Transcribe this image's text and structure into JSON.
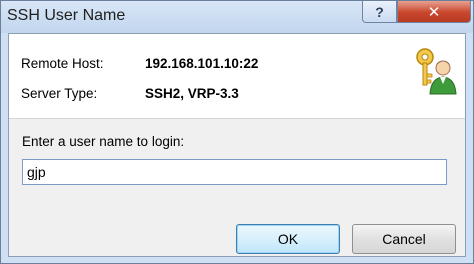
{
  "window": {
    "title": "SSH User Name",
    "help_label": "?",
    "close_label": "✕"
  },
  "info": {
    "remote_host_label": "Remote Host:",
    "remote_host_value": "192.168.101.10:22",
    "server_type_label": "Server Type:",
    "server_type_value": "SSH2, VRP-3.3",
    "icon": "key-user-icon"
  },
  "login": {
    "prompt": "Enter a user name to login:",
    "username_value": "gjp"
  },
  "buttons": {
    "ok": "OK",
    "cancel": "Cancel"
  }
}
